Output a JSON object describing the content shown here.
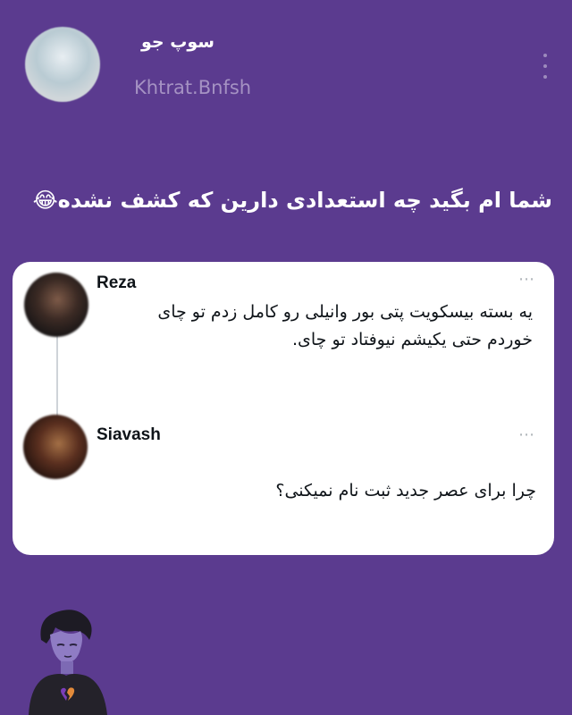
{
  "header": {
    "display_name": "سوپ جو",
    "username": "Khtrat.Bnfsh"
  },
  "post": {
    "caption": "شما ام بگید چه استعدادی دارین که کشف نشده😂"
  },
  "thread": [
    {
      "author": "Reza",
      "lines": [
        "یه بسته بیسکویت پتی بور وانیلی رو کامل زدم تو چای",
        "خوردم حتی یکیشم نیوفتاد تو چای."
      ]
    },
    {
      "author": "Siavash",
      "lines": [
        "چرا برای عصر جدید ثبت نام نمیکنی؟"
      ]
    }
  ],
  "more_glyph": "⋯",
  "colors": {
    "background": "#5b3b8f",
    "card": "#ffffff",
    "username": "#a592c3"
  },
  "icons": [
    "kebab-menu-icon",
    "more-dots-icon",
    "broken-heart-icon"
  ]
}
